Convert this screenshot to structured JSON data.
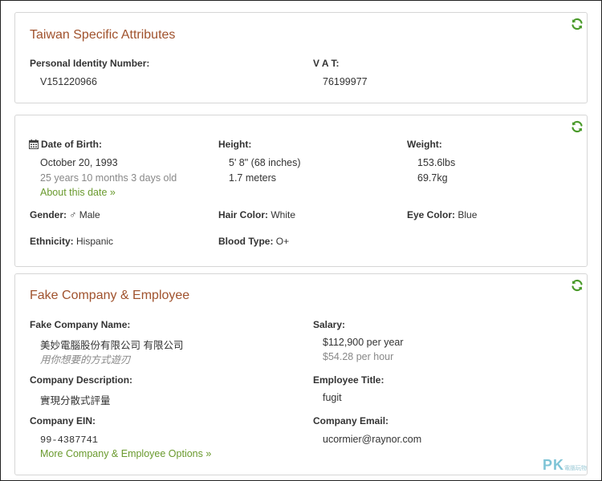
{
  "taiwan": {
    "title": "Taiwan Specific Attributes",
    "pin_label": "Personal Identity Number:",
    "pin_value": "V151220966",
    "vat_label": "V A T:",
    "vat_value": "76199977"
  },
  "personal": {
    "dob_label": "Date of Birth:",
    "dob_value": "October 20, 1993",
    "age": "25 years 10 months 3 days old",
    "about_link": "About this date »",
    "height_label": "Height:",
    "height_imperial": "5' 8\" (68 inches)",
    "height_metric": "1.7 meters",
    "weight_label": "Weight:",
    "weight_lbs": "153.6lbs",
    "weight_kg": "69.7kg",
    "gender_label": "Gender:",
    "gender_symbol": "♂",
    "gender_value": "Male",
    "hair_label": "Hair Color:",
    "hair_value": "White",
    "eye_label": "Eye Color:",
    "eye_value": "Blue",
    "ethnicity_label": "Ethnicity:",
    "ethnicity_value": "Hispanic",
    "blood_label": "Blood Type:",
    "blood_value": "O+"
  },
  "company": {
    "title": "Fake Company & Employee",
    "name_label": "Fake Company Name:",
    "name_value": "美妙電腦股份有限公司 有限公司",
    "slogan": "用你想要的方式遊刃",
    "salary_label": "Salary:",
    "salary_year": "$112,900 per year",
    "salary_hour": "$54.28 per hour",
    "desc_label": "Company Description:",
    "desc_value": "實現分散式評量",
    "title_label": "Employee Title:",
    "title_value": "fugit",
    "ein_label": "Company EIN:",
    "ein_value": "99-4387741",
    "more_link": "More Company & Employee Options »",
    "email_label": "Company Email:",
    "email_value": "ucormier@raynor.com"
  },
  "icons": {
    "refresh": "refresh-icon",
    "calendar": "calendar-icon"
  },
  "watermark": {
    "text": "PK",
    "sub": "電腦玩物"
  },
  "colors": {
    "title": "#a0522d",
    "link": "#6a9a2e",
    "refresh": "#4a9a2a",
    "muted": "#888888"
  }
}
